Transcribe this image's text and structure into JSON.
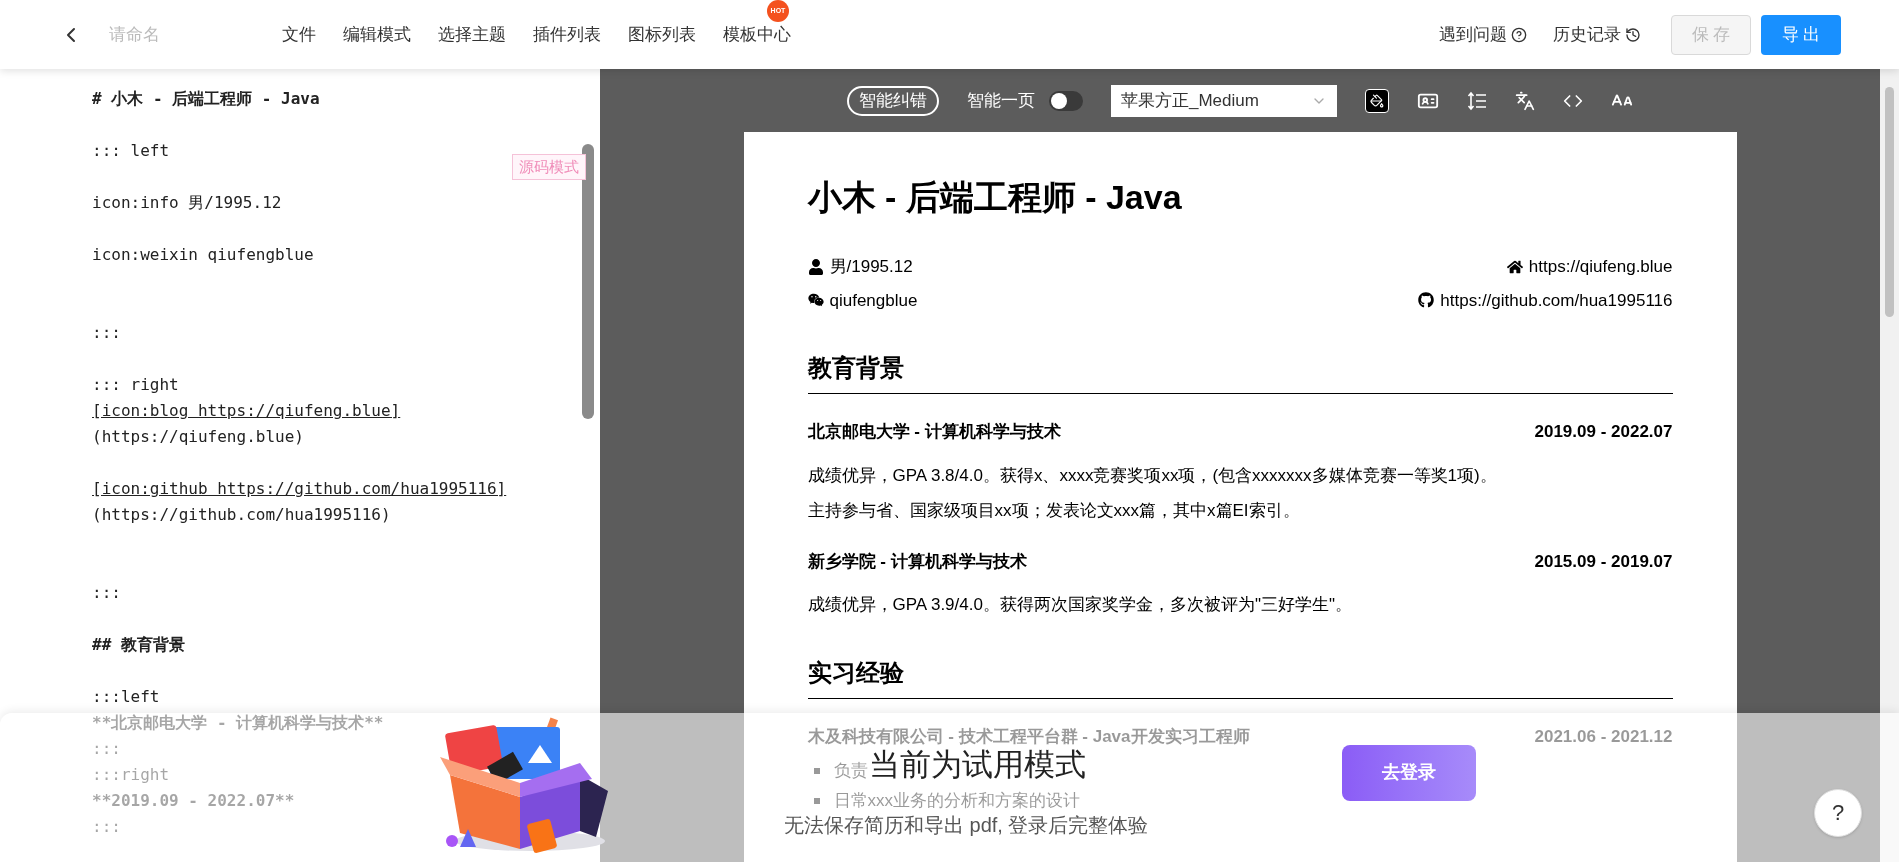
{
  "topbar": {
    "title_placeholder": "请命名",
    "menu": [
      {
        "label": "文件"
      },
      {
        "label": "编辑模式"
      },
      {
        "label": "选择主题"
      },
      {
        "label": "插件列表"
      },
      {
        "label": "图标列表"
      },
      {
        "label": "模板中心",
        "badge": "HOT"
      }
    ],
    "help": "遇到问题",
    "history": "历史记录",
    "save": {
      "label": "保 存",
      "disabled": true
    },
    "export": "导 出"
  },
  "editor": {
    "mode_badge": "源码模式",
    "lines": [
      {
        "kind": "heading",
        "text": "# 小木 - 后端工程师 - Java"
      },
      {
        "kind": "blank"
      },
      {
        "kind": "plain",
        "text": "::: left"
      },
      {
        "kind": "blank"
      },
      {
        "kind": "plain",
        "text": "icon:info 男/1995.12"
      },
      {
        "kind": "blank"
      },
      {
        "kind": "plain",
        "text": "icon:weixin qiufengblue"
      },
      {
        "kind": "blank"
      },
      {
        "kind": "blank"
      },
      {
        "kind": "plain",
        "text": ":::"
      },
      {
        "kind": "blank"
      },
      {
        "kind": "plain",
        "text": "::: right"
      },
      {
        "kind": "link",
        "text": "[icon:blog https://qiufeng.blue]"
      },
      {
        "kind": "plain",
        "text": "(https://qiufeng.blue)"
      },
      {
        "kind": "blank"
      },
      {
        "kind": "link",
        "text": "[icon:github https://github.com/hua1995116]"
      },
      {
        "kind": "plain",
        "text": "(https://github.com/hua1995116)"
      },
      {
        "kind": "blank"
      },
      {
        "kind": "blank"
      },
      {
        "kind": "plain",
        "text": ":::"
      },
      {
        "kind": "blank"
      },
      {
        "kind": "heading",
        "text": "## 教育背景"
      },
      {
        "kind": "blank"
      },
      {
        "kind": "plain",
        "text": ":::left"
      },
      {
        "kind": "heading",
        "text": "**北京邮电大学 - 计算机科学与技术**"
      },
      {
        "kind": "plain",
        "text": ":::"
      },
      {
        "kind": "plain",
        "text": ":::right"
      },
      {
        "kind": "heading",
        "text": "**2019.09 - 2022.07**"
      },
      {
        "kind": "plain",
        "text": ":::"
      }
    ]
  },
  "preview_toolbar": {
    "autocorrect": "智能纠错",
    "one_page": {
      "label": "智能一页",
      "on": false
    },
    "font": "苹果方正_Medium"
  },
  "resume": {
    "name": "小木 - 后端工程师 - Java",
    "contacts": [
      {
        "kind": "user",
        "text": "男/1995.12"
      },
      {
        "kind": "home",
        "text": "https://qiufeng.blue"
      },
      {
        "kind": "wechat",
        "text": "qiufengblue"
      },
      {
        "kind": "github",
        "text": "https://github.com/hua1995116"
      }
    ],
    "sections": [
      {
        "title": "教育背景",
        "entries": [
          {
            "org": "北京邮电大学 - 计算机科学与技术",
            "date": "2019.09 - 2022.07",
            "paragraphs": [
              "成绩优异，GPA 3.8/4.0。获得x、xxxx竞赛奖项xx项，(包含xxxxxxx多媒体竞赛一等奖1项)。",
              "主持参与省、国家级项目xx项；发表论文xxx篇，其中x篇EI索引。"
            ]
          },
          {
            "org": "新乡学院 - 计算机科学与技术",
            "date": "2015.09 - 2019.07",
            "paragraphs": [
              "成绩优异，GPA 3.9/4.0。获得两次国家奖学金，多次被评为\"三好学生\"。"
            ]
          }
        ]
      },
      {
        "title": "实习经验",
        "entries": [
          {
            "org": "木及科技有限公司 - 技术工程平台群 - Java开发实习工程师",
            "date": "2021.06 - 2021.12",
            "bullets": [
              "负责",
              "日常xxx业务的分析和方案的设计"
            ]
          }
        ]
      }
    ]
  },
  "trial_banner": {
    "title": "当前为试用模式",
    "subtitle": "无法保存简历和导出 pdf, 登录后完整体验",
    "login": "去登录",
    "help": "?"
  }
}
